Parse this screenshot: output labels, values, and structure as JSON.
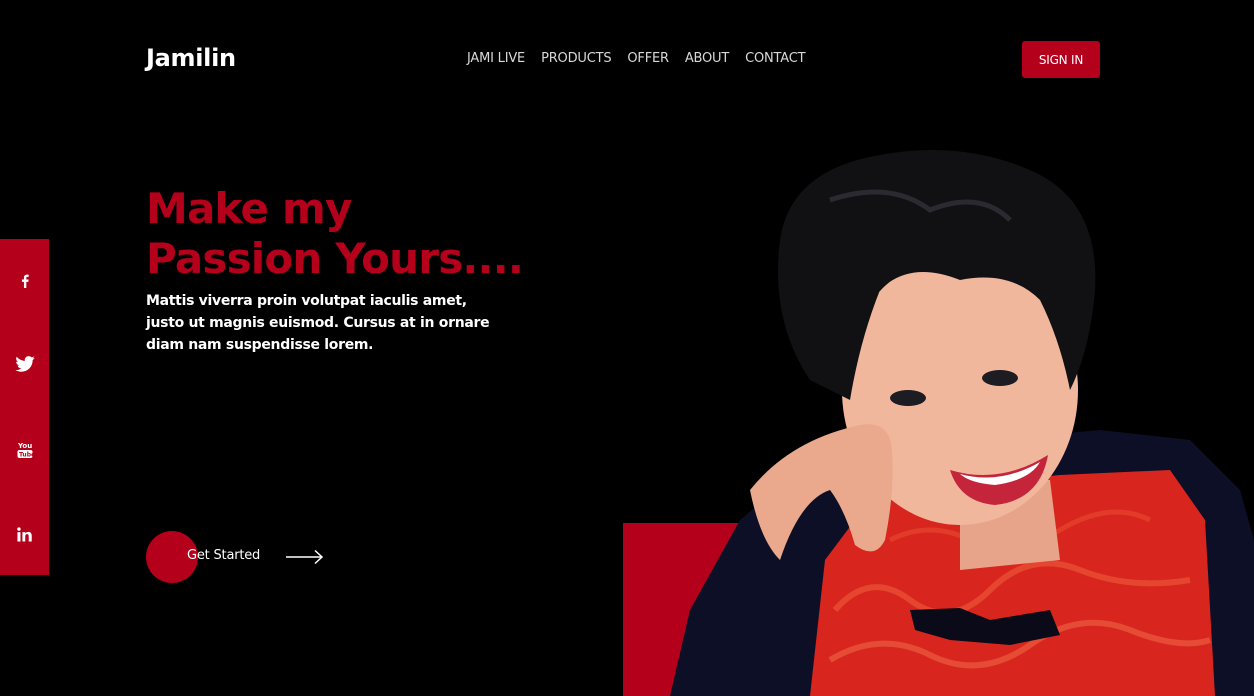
{
  "brand": {
    "logo_text": "Jamilin"
  },
  "nav": {
    "items": [
      {
        "label": "JAMI LIVE"
      },
      {
        "label": "PRODUCTS"
      },
      {
        "label": "OFFER"
      },
      {
        "label": "ABOUT"
      },
      {
        "label": "CONTACT"
      }
    ]
  },
  "header": {
    "signin_label": "SIGN IN"
  },
  "social": {
    "icons": [
      "facebook-icon",
      "twitter-icon",
      "youtube-icon",
      "linkedin-icon"
    ]
  },
  "hero": {
    "headline_line1": "Make my",
    "headline_line2": "Passion Yours....",
    "description": "Mattis viverra proin volutpat iaculis amet, justo ut magnis euismod. Cursus at in ornare diam nam suspendisse lorem.",
    "cta_label": "Get Started"
  },
  "colors": {
    "accent": "#b5001c",
    "background": "#000000",
    "text": "#ffffff"
  }
}
